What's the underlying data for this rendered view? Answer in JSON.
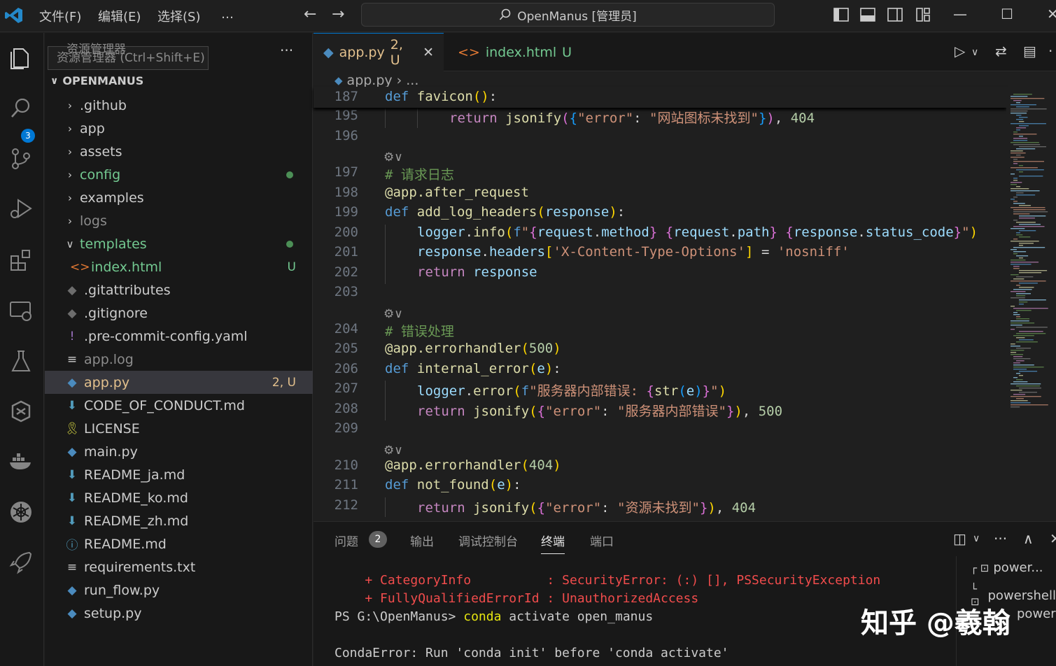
{
  "titlebar": {
    "menus": [
      "文件(F)",
      "编辑(E)",
      "选择(S)",
      "…"
    ],
    "search_text": "OpenManus [管理员]"
  },
  "activity": {
    "scm_badge": "3"
  },
  "sidebar": {
    "tooltip": "资源管理器 (Ctrl+Shift+E)",
    "tooltip_ghost": "资源管理器",
    "root_label": "OPENMANUS",
    "items": [
      {
        "label": ".github",
        "type": "folder",
        "color": "#cccccc"
      },
      {
        "label": "app",
        "type": "folder",
        "color": "#cccccc"
      },
      {
        "label": "assets",
        "type": "folder",
        "color": "#cccccc"
      },
      {
        "label": "config",
        "type": "folder",
        "color": "#73c991",
        "dot": true
      },
      {
        "label": "examples",
        "type": "folder",
        "color": "#cccccc"
      },
      {
        "label": "logs",
        "type": "folder",
        "color": "#8c8c8c"
      },
      {
        "label": "templates",
        "type": "folder-open",
        "color": "#73c991",
        "dot": true
      },
      {
        "label": "index.html",
        "type": "html",
        "color": "#73c991",
        "status": "U"
      },
      {
        "label": ".gitattributes",
        "type": "git",
        "color": "#cccccc"
      },
      {
        "label": ".gitignore",
        "type": "git",
        "color": "#cccccc"
      },
      {
        "label": ".pre-commit-config.yaml",
        "type": "yaml",
        "color": "#cccccc"
      },
      {
        "label": "app.log",
        "type": "log",
        "color": "#8c8c8c"
      },
      {
        "label": "app.py",
        "type": "py",
        "color": "#e2c08d",
        "status": "2, U",
        "selected": true
      },
      {
        "label": "CODE_OF_CONDUCT.md",
        "type": "md",
        "color": "#cccccc"
      },
      {
        "label": "LICENSE",
        "type": "license",
        "color": "#cccccc"
      },
      {
        "label": "main.py",
        "type": "py",
        "color": "#cccccc"
      },
      {
        "label": "README_ja.md",
        "type": "md",
        "color": "#cccccc"
      },
      {
        "label": "README_ko.md",
        "type": "md",
        "color": "#cccccc"
      },
      {
        "label": "README_zh.md",
        "type": "md",
        "color": "#cccccc"
      },
      {
        "label": "README.md",
        "type": "info",
        "color": "#cccccc"
      },
      {
        "label": "requirements.txt",
        "type": "txt",
        "color": "#cccccc"
      },
      {
        "label": "run_flow.py",
        "type": "py",
        "color": "#cccccc"
      },
      {
        "label": "setup.py",
        "type": "py",
        "color": "#cccccc"
      }
    ]
  },
  "tabs": [
    {
      "label": "app.py",
      "status": "2, U",
      "active": true
    },
    {
      "label": "index.html",
      "status": "U",
      "active": false
    }
  ],
  "breadcrumb": {
    "file": "app.py",
    "rest": "..."
  },
  "editor": {
    "sticky": {
      "num": "187",
      "text": "def favicon():"
    },
    "lines": [
      {
        "num": "195",
        "html": "<span class='ctl'>return</span> <span class='fn'>jsonify</span><span class='br2'>(</span><span class='br3'>{</span><span class='str'>\"error\"</span><span class='pl'>: </span><span class='str'>\"网站图标未找到\"</span><span class='br3'>}</span><span class='br2'>)</span><span class='pl'>, </span><span class='num'>404</span>",
        "indent": 2
      },
      {
        "num": "196",
        "html": "",
        "indent": 0
      },
      {
        "num": "197",
        "html": "<span class='cm'># 请求日志</span>",
        "indent": 0,
        "lens": true
      },
      {
        "num": "198",
        "html": "<span class='fn'>@app.after_request</span>",
        "indent": 0
      },
      {
        "num": "199",
        "html": "<span class='kw'>def</span> <span class='fn'>add_log_headers</span><span class='br'>(</span><span class='var'>response</span><span class='br'>)</span><span class='pl'>:</span>",
        "indent": 0
      },
      {
        "num": "200",
        "html": "<span class='var'>logger</span><span class='pl'>.</span><span class='fn'>info</span><span class='br'>(</span><span class='kw'>f</span><span class='str'>\"</span><span class='br2'>{</span><span class='var'>request</span><span class='pl'>.</span><span class='var'>method</span><span class='br2'>}</span><span class='str'> </span><span class='br2'>{</span><span class='var'>request</span><span class='pl'>.</span><span class='var'>path</span><span class='br2'>}</span><span class='str'> </span><span class='br2'>{</span><span class='var'>response</span><span class='pl'>.</span><span class='var'>status_code</span><span class='br2'>}</span><span class='str'>\"</span><span class='br'>)</span>",
        "indent": 1
      },
      {
        "num": "201",
        "html": "<span class='var'>response</span><span class='pl'>.</span><span class='var'>headers</span><span class='br'>[</span><span class='str'>'X-Content-Type-Options'</span><span class='br'>]</span><span class='pl'> = </span><span class='str'>'nosniff'</span>",
        "indent": 1
      },
      {
        "num": "202",
        "html": "<span class='ctl'>return</span> <span class='var'>response</span>",
        "indent": 1
      },
      {
        "num": "203",
        "html": "",
        "indent": 0
      },
      {
        "num": "204",
        "html": "<span class='cm'># 错误处理</span>",
        "indent": 0,
        "lens": true
      },
      {
        "num": "205",
        "html": "<span class='fn'>@app.errorhandler</span><span class='br'>(</span><span class='num'>500</span><span class='br'>)</span>",
        "indent": 0
      },
      {
        "num": "206",
        "html": "<span class='kw'>def</span> <span class='fn'>internal_error</span><span class='br'>(</span><span class='var'>e</span><span class='br'>)</span><span class='pl'>:</span>",
        "indent": 0
      },
      {
        "num": "207",
        "html": "<span class='var'>logger</span><span class='pl'>.</span><span class='fn'>error</span><span class='br'>(</span><span class='kw'>f</span><span class='str'>\"服务器内部错误: </span><span class='br2'>{</span><span class='fn'>str</span><span class='br3'>(</span><span class='var'>e</span><span class='br3'>)</span><span class='br2'>}</span><span class='str'>\"</span><span class='br'>)</span>",
        "indent": 1
      },
      {
        "num": "208",
        "html": "<span class='ctl'>return</span> <span class='fn'>jsonify</span><span class='br'>(</span><span class='br2'>{</span><span class='str'>\"error\"</span><span class='pl'>: </span><span class='str'>\"服务器内部错误\"</span><span class='br2'>}</span><span class='br'>)</span><span class='pl'>, </span><span class='num'>500</span>",
        "indent": 1
      },
      {
        "num": "209",
        "html": "",
        "indent": 0
      },
      {
        "num": "210",
        "html": "<span class='fn'>@app.errorhandler</span><span class='br'>(</span><span class='num'>404</span><span class='br'>)</span>",
        "indent": 0,
        "lens": true
      },
      {
        "num": "211",
        "html": "<span class='kw'>def</span> <span class='fn'>not_found</span><span class='br'>(</span><span class='var'>e</span><span class='br'>)</span><span class='pl'>:</span>",
        "indent": 0
      },
      {
        "num": "212",
        "html": "<span class='ctl'>return</span> <span class='fn'>jsonify</span><span class='br'>(</span><span class='br2'>{</span><span class='str'>\"error\"</span><span class='pl'>: </span><span class='str'>\"资源未找到\"</span><span class='br2'>}</span><span class='br'>)</span><span class='pl'>, </span><span class='num'>404</span>",
        "indent": 1
      }
    ]
  },
  "panel": {
    "tabs": [
      "问题",
      "输出",
      "调试控制台",
      "终端",
      "端口"
    ],
    "problems_count": "2",
    "terminal_lines": [
      {
        "kind": "err",
        "text": "    + CategoryInfo          : SecurityError: (:) [], PSSecurityException"
      },
      {
        "kind": "err",
        "text": "    + FullyQualifiedErrorId : UnauthorizedAccess"
      },
      {
        "kind": "prompt",
        "prompt": "PS G:\\OpenManus> ",
        "cmd": "conda",
        "args": " activate open_manus"
      },
      {
        "kind": "plain",
        "text": ""
      },
      {
        "kind": "plain",
        "text": "CondaError: Run 'conda init' before 'conda activate'"
      }
    ],
    "terminals": [
      "power...",
      "powershell",
      "powershell"
    ]
  },
  "watermark": "知乎 @羲翰"
}
